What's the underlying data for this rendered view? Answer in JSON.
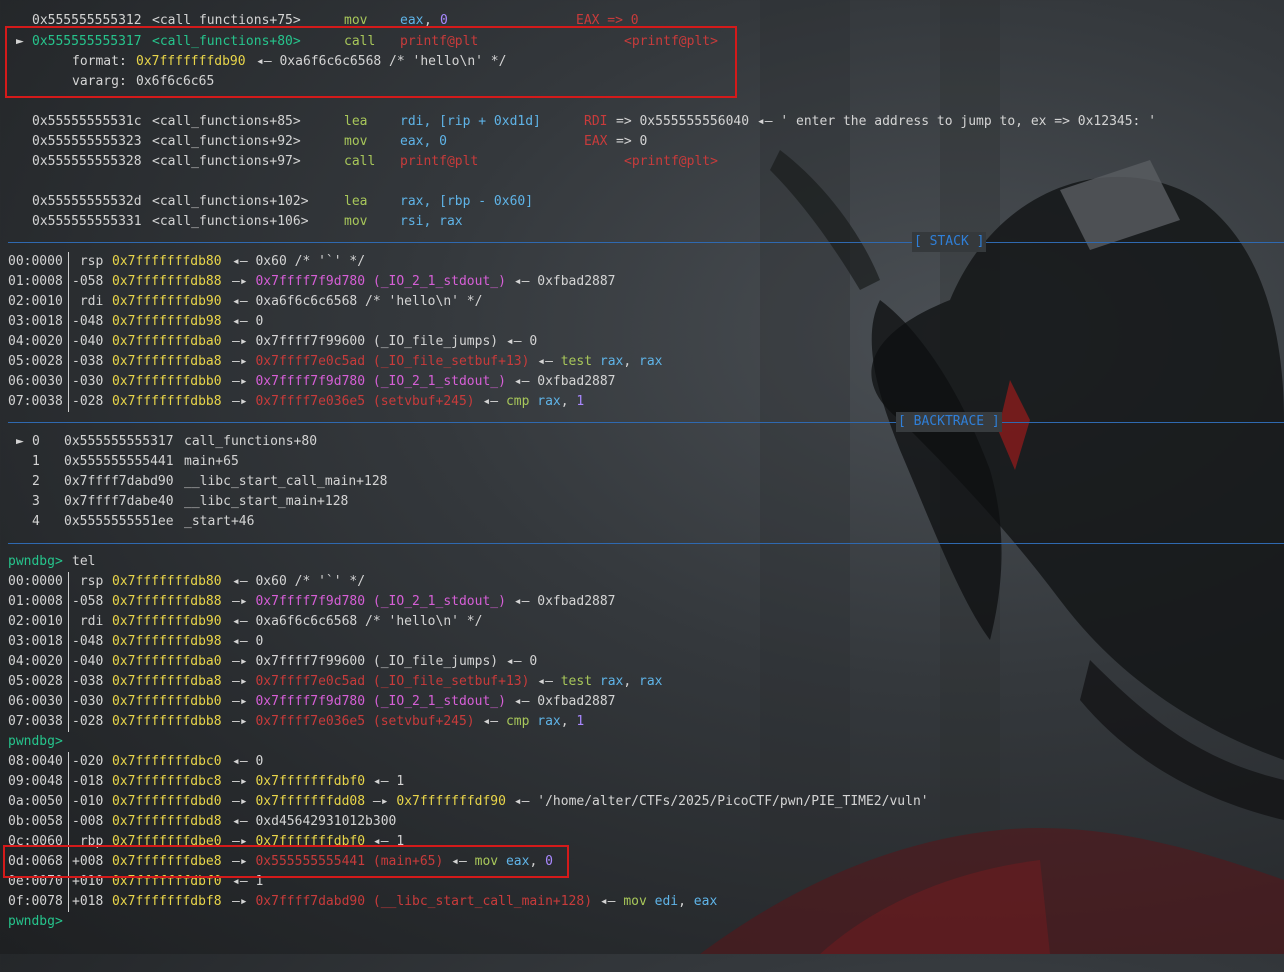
{
  "disasm": {
    "top_line": {
      "addr": "0x555555555312",
      "sym": "<call_functions+75>",
      "op": "mov",
      "args": [
        "eax",
        "0"
      ],
      "comment": "EAX => 0"
    },
    "current": {
      "marker": "►",
      "addr": "0x555555555317",
      "sym": "<call_functions+80>",
      "op": "call",
      "target": "printf@plt",
      "target_angle": "<printf@plt>"
    },
    "format_label": "format:",
    "format_value": "0x7fffffffdb90",
    "format_arrow": "◂— 0xa6f6c6c6568 /* 'hello\\n' */",
    "vararg_label": "vararg:",
    "vararg_value": "0x6f6c6c65",
    "lines": [
      {
        "addr": "0x55555555531c",
        "sym": "<call_functions+85>",
        "op": "lea",
        "args": "rdi, [rip + 0xd1d]",
        "comment_reg": "RDI",
        "comment": "=> 0x555555556040 ◂— ' enter the address to jump to, ex => 0x12345: '"
      },
      {
        "addr": "0x555555555323",
        "sym": "<call_functions+92>",
        "op": "mov",
        "args": "eax, 0",
        "comment_reg": "EAX",
        "comment": "=> 0"
      },
      {
        "addr": "0x555555555328",
        "sym": "<call_functions+97>",
        "op": "call",
        "target": "printf@plt",
        "target_angle": "<printf@plt>"
      },
      {
        "addr": "0x55555555532d",
        "sym": "<call_functions+102>",
        "op": "lea",
        "args": "rax, [rbp - 0x60]"
      },
      {
        "addr": "0x555555555331",
        "sym": "<call_functions+106>",
        "op": "mov",
        "args": "rsi, rax"
      }
    ]
  },
  "sections": {
    "stack": "[ STACK ]",
    "backtrace": "[ BACKTRACE ]"
  },
  "stack": [
    {
      "idx": "00:0000",
      "off": " rsp",
      "addr": "0x7fffffffdb80",
      "rest": [
        [
          "w",
          "◂— 0x60 /* '`' */"
        ]
      ]
    },
    {
      "idx": "01:0008",
      "off": "-058",
      "addr": "0x7fffffffdb88",
      "rest": [
        [
          "w",
          "—▸ "
        ],
        [
          "m",
          "0x7ffff7f9d780 (_IO_2_1_stdout_)"
        ],
        [
          "w",
          " ◂— 0xfbad2887"
        ]
      ]
    },
    {
      "idx": "02:0010",
      "off": " rdi",
      "addr": "0x7fffffffdb90",
      "rest": [
        [
          "w",
          "◂— 0xa6f6c6c6568 /* 'hello\\n' */"
        ]
      ]
    },
    {
      "idx": "03:0018",
      "off": "-048",
      "addr": "0x7fffffffdb98",
      "rest": [
        [
          "w",
          "◂— 0"
        ]
      ]
    },
    {
      "idx": "04:0020",
      "off": "-040",
      "addr": "0x7fffffffdba0",
      "rest": [
        [
          "w",
          "—▸ 0x7ffff7f99600 (_IO_file_jumps) ◂— 0"
        ]
      ]
    },
    {
      "idx": "05:0028",
      "off": "-038",
      "addr": "0x7fffffffdba8",
      "rest": [
        [
          "w",
          "—▸ "
        ],
        [
          "r",
          "0x7ffff7e0c5ad (_IO_file_setbuf+13)"
        ],
        [
          "w",
          " ◂— "
        ],
        [
          "gl",
          "test "
        ],
        [
          "b",
          "rax"
        ],
        [
          "w",
          ", "
        ],
        [
          "b",
          "rax"
        ]
      ]
    },
    {
      "idx": "06:0030",
      "off": "-030",
      "addr": "0x7fffffffdbb0",
      "rest": [
        [
          "w",
          "—▸ "
        ],
        [
          "m",
          "0x7ffff7f9d780 (_IO_2_1_stdout_)"
        ],
        [
          "w",
          " ◂— 0xfbad2887"
        ]
      ]
    },
    {
      "idx": "07:0038",
      "off": "-028",
      "addr": "0x7fffffffdbb8",
      "rest": [
        [
          "w",
          "—▸ "
        ],
        [
          "r",
          "0x7ffff7e036e5 (setvbuf+245)"
        ],
        [
          "w",
          " ◂— "
        ],
        [
          "gl",
          "cmp "
        ],
        [
          "b",
          "rax"
        ],
        [
          "w",
          ", "
        ],
        [
          "p",
          "1"
        ]
      ]
    }
  ],
  "backtrace": [
    {
      "marker": "►",
      "num": "0",
      "addr": "0x555555555317",
      "sym": "call_functions+80"
    },
    {
      "marker": "",
      "num": "1",
      "addr": "0x555555555441",
      "sym": "main+65"
    },
    {
      "marker": "",
      "num": "2",
      "addr": "0x7ffff7dabd90",
      "sym": "__libc_start_call_main+128"
    },
    {
      "marker": "",
      "num": "3",
      "addr": "0x7ffff7dabe40",
      "sym": "__libc_start_main+128"
    },
    {
      "marker": "",
      "num": "4",
      "addr": "0x5555555551ee",
      "sym": "_start+46"
    }
  ],
  "prompt": "pwndbg>",
  "command": "tel",
  "tel2": [
    {
      "idx": "08:0040",
      "off": "-020",
      "addr": "0x7fffffffdbc0",
      "rest": [
        [
          "w",
          "◂— 0"
        ]
      ]
    },
    {
      "idx": "09:0048",
      "off": "-018",
      "addr": "0x7fffffffdbc8",
      "rest": [
        [
          "w",
          "—▸ "
        ],
        [
          "y",
          "0x7fffffffdbf0"
        ],
        [
          "w",
          " ◂— 1"
        ]
      ]
    },
    {
      "idx": "0a:0050",
      "off": "-010",
      "addr": "0x7fffffffdbd0",
      "rest": [
        [
          "w",
          "—▸ "
        ],
        [
          "y",
          "0x7fffffffdd08"
        ],
        [
          "w",
          " —▸ "
        ],
        [
          "y",
          "0x7fffffffdf90"
        ],
        [
          "w",
          " ◂— '/home/alter/CTFs/2025/PicoCTF/pwn/PIE_TIME2/vuln'"
        ]
      ]
    },
    {
      "idx": "0b:0058",
      "off": "-008",
      "addr": "0x7fffffffdbd8",
      "rest": [
        [
          "w",
          "◂— 0xd45642931012b300"
        ]
      ]
    },
    {
      "idx": "0c:0060",
      "off": " rbp",
      "addr": "0x7fffffffdbe0",
      "rest": [
        [
          "w",
          "—▸ "
        ],
        [
          "y",
          "0x7fffffffdbf0"
        ],
        [
          "w",
          " ◂— 1"
        ]
      ]
    },
    {
      "idx": "0d:0068",
      "off": "+008",
      "addr": "0x7fffffffdbe8",
      "rest": [
        [
          "w",
          "—▸ "
        ],
        [
          "r",
          "0x555555555441 (main+65)"
        ],
        [
          "w",
          " ◂— "
        ],
        [
          "gl",
          "mov "
        ],
        [
          "b",
          "eax"
        ],
        [
          "w",
          ", "
        ],
        [
          "p",
          "0"
        ]
      ]
    },
    {
      "idx": "0e:0070",
      "off": "+010",
      "addr": "0x7fffffffdbf0",
      "rest": [
        [
          "w",
          "◂— 1"
        ]
      ]
    },
    {
      "idx": "0f:0078",
      "off": "+018",
      "addr": "0x7fffffffdbf8",
      "rest": [
        [
          "w",
          "—▸ "
        ],
        [
          "r",
          "0x7ffff7dabd90 (__libc_start_call_main+128)"
        ],
        [
          "w",
          " ◂— "
        ],
        [
          "gl",
          "mov "
        ],
        [
          "b",
          "edi"
        ],
        [
          "w",
          ", "
        ],
        [
          "b",
          "eax"
        ]
      ]
    }
  ]
}
